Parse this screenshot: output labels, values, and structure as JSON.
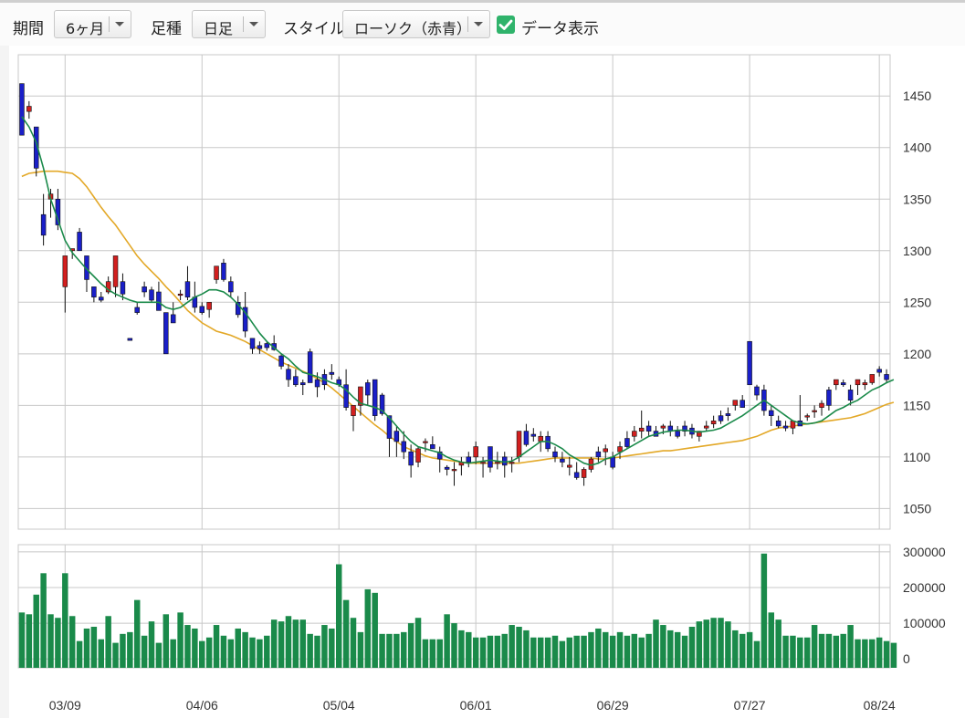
{
  "toolbar": {
    "period_label": "期間",
    "period_value": "6ヶ月",
    "candle_label": "足種",
    "candle_value": "日足",
    "style_label": "スタイル",
    "style_value": "ローソク（赤青）",
    "data_display_label": "データ表示",
    "data_display_checked": true
  },
  "colors": {
    "up": "#d21f1f",
    "down": "#1a1fc8",
    "ma_short": "#1a8a4a",
    "ma_long": "#e3a827",
    "volume": "#1a8a4a",
    "grid": "#c8c8c8"
  },
  "chart_data": [
    {
      "type": "candlestick",
      "ylim": [
        1030,
        1490
      ],
      "y_ticks": [
        1050,
        1100,
        1150,
        1200,
        1250,
        1300,
        1350,
        1400,
        1450
      ],
      "x_ticks": [
        "03/09",
        "04/06",
        "05/04",
        "06/01",
        "06/29",
        "07/27",
        "08/24"
      ],
      "x_tick_index": [
        6,
        25,
        44,
        63,
        82,
        101,
        119
      ],
      "candles": [
        [
          1462,
          1412,
          1462,
          1412
        ],
        [
          1435,
          1445,
          1428,
          1440
        ],
        [
          1420,
          1420,
          1372,
          1380
        ],
        [
          1335,
          1355,
          1305,
          1315
        ],
        [
          1350,
          1360,
          1332,
          1355
        ],
        [
          1350,
          1360,
          1320,
          1325
        ],
        [
          1265,
          1265,
          1240,
          1295
        ],
        [
          1300,
          1300,
          1292,
          1302
        ],
        [
          1318,
          1322,
          1300,
          1300
        ],
        [
          1295,
          1295,
          1260,
          1272
        ],
        [
          1265,
          1265,
          1250,
          1255
        ],
        [
          1255,
          1260,
          1250,
          1252
        ],
        [
          1260,
          1275,
          1258,
          1270
        ],
        [
          1265,
          1265,
          1255,
          1295
        ],
        [
          1270,
          1278,
          1252,
          1258
        ],
        [
          1215,
          1210,
          1225,
          1213
        ],
        [
          1245,
          1250,
          1238,
          1240
        ],
        [
          1265,
          1270,
          1255,
          1260
        ],
        [
          1262,
          1265,
          1250,
          1252
        ],
        [
          1260,
          1270,
          1250,
          1242
        ],
        [
          1240,
          1240,
          1200,
          1200
        ],
        [
          1238,
          1250,
          1230,
          1230
        ],
        [
          1258,
          1262,
          1252,
          1258
        ],
        [
          1270,
          1285,
          1252,
          1255
        ],
        [
          1255,
          1270,
          1240,
          1245
        ],
        [
          1246,
          1250,
          1238,
          1240
        ],
        [
          1243,
          1250,
          1235,
          1250
        ],
        [
          1272,
          1275,
          1268,
          1285
        ],
        [
          1288,
          1292,
          1270,
          1272
        ],
        [
          1270,
          1275,
          1255,
          1260
        ],
        [
          1250,
          1256,
          1235,
          1238
        ],
        [
          1245,
          1260,
          1216,
          1222
        ],
        [
          1215,
          1215,
          1200,
          1205
        ],
        [
          1208,
          1212,
          1200,
          1205
        ],
        [
          1210,
          1212,
          1203,
          1206
        ],
        [
          1210,
          1218,
          1203,
          1204
        ],
        [
          1198,
          1200,
          1185,
          1188
        ],
        [
          1185,
          1190,
          1168,
          1175
        ],
        [
          1178,
          1185,
          1168,
          1170
        ],
        [
          1172,
          1175,
          1160,
          1170
        ],
        [
          1202,
          1205,
          1172,
          1172
        ],
        [
          1175,
          1182,
          1158,
          1168
        ],
        [
          1180,
          1185,
          1165,
          1170
        ],
        [
          1182,
          1190,
          1175,
          1180
        ],
        [
          1175,
          1178,
          1168,
          1170
        ],
        [
          1170,
          1185,
          1145,
          1148
        ],
        [
          1140,
          1150,
          1125,
          1150
        ],
        [
          1150,
          1165,
          1140,
          1168
        ],
        [
          1172,
          1175,
          1150,
          1160
        ],
        [
          1175,
          1175,
          1135,
          1140
        ],
        [
          1160,
          1162,
          1140,
          1142
        ],
        [
          1140,
          1140,
          1100,
          1118
        ],
        [
          1125,
          1130,
          1100,
          1115
        ],
        [
          1115,
          1125,
          1098,
          1105
        ],
        [
          1105,
          1112,
          1080,
          1092
        ],
        [
          1095,
          1110,
          1090,
          1108
        ],
        [
          1115,
          1118,
          1105,
          1115
        ],
        [
          1112,
          1120,
          1110,
          1108
        ],
        [
          1105,
          1110,
          1085,
          1098
        ],
        [
          1090,
          1092,
          1082,
          1088
        ],
        [
          1088,
          1095,
          1072,
          1088
        ],
        [
          1092,
          1100,
          1082,
          1095
        ],
        [
          1100,
          1105,
          1090,
          1095
        ],
        [
          1100,
          1115,
          1093,
          1110
        ],
        [
          1095,
          1100,
          1080,
          1095
        ],
        [
          1110,
          1110,
          1085,
          1090
        ],
        [
          1095,
          1105,
          1088,
          1095
        ],
        [
          1100,
          1105,
          1080,
          1092
        ],
        [
          1095,
          1100,
          1085,
          1095
        ],
        [
          1100,
          1110,
          1095,
          1125
        ],
        [
          1125,
          1132,
          1110,
          1112
        ],
        [
          1122,
          1128,
          1115,
          1120
        ],
        [
          1115,
          1125,
          1105,
          1120
        ],
        [
          1120,
          1125,
          1105,
          1108
        ],
        [
          1105,
          1110,
          1095,
          1100
        ],
        [
          1098,
          1105,
          1090,
          1095
        ],
        [
          1090,
          1100,
          1082,
          1092
        ],
        [
          1085,
          1095,
          1078,
          1080
        ],
        [
          1080,
          1090,
          1072,
          1088
        ],
        [
          1088,
          1100,
          1085,
          1098
        ],
        [
          1105,
          1110,
          1095,
          1100
        ],
        [
          1105,
          1112,
          1092,
          1108
        ],
        [
          1100,
          1105,
          1088,
          1090
        ],
        [
          1105,
          1115,
          1098,
          1110
        ],
        [
          1118,
          1125,
          1108,
          1110
        ],
        [
          1120,
          1130,
          1115,
          1125
        ],
        [
          1125,
          1145,
          1118,
          1128
        ],
        [
          1130,
          1135,
          1120,
          1125
        ],
        [
          1125,
          1130,
          1120,
          1120
        ],
        [
          1128,
          1132,
          1122,
          1130
        ],
        [
          1130,
          1135,
          1120,
          1125
        ],
        [
          1125,
          1130,
          1118,
          1120
        ],
        [
          1130,
          1135,
          1120,
          1125
        ],
        [
          1128,
          1132,
          1118,
          1122
        ],
        [
          1120,
          1125,
          1115,
          1125
        ],
        [
          1128,
          1135,
          1125,
          1130
        ],
        [
          1132,
          1140,
          1128,
          1135
        ],
        [
          1140,
          1145,
          1132,
          1135
        ],
        [
          1142,
          1148,
          1135,
          1140
        ],
        [
          1150,
          1155,
          1145,
          1155
        ],
        [
          1155,
          1160,
          1148,
          1148
        ],
        [
          1212,
          1205,
          1175,
          1170
        ],
        [
          1168,
          1170,
          1155,
          1160
        ],
        [
          1165,
          1170,
          1140,
          1145
        ],
        [
          1145,
          1150,
          1130,
          1140
        ],
        [
          1135,
          1140,
          1128,
          1130
        ],
        [
          1130,
          1135,
          1125,
          1128
        ],
        [
          1128,
          1135,
          1122,
          1135
        ],
        [
          1135,
          1160,
          1130,
          1130
        ],
        [
          1140,
          1142,
          1135,
          1140
        ],
        [
          1145,
          1150,
          1138,
          1145
        ],
        [
          1148,
          1155,
          1140,
          1152
        ],
        [
          1165,
          1168,
          1145,
          1150
        ],
        [
          1170,
          1175,
          1165,
          1175
        ],
        [
          1172,
          1175,
          1168,
          1170
        ],
        [
          1165,
          1170,
          1150,
          1155
        ],
        [
          1170,
          1175,
          1160,
          1175
        ],
        [
          1170,
          1175,
          1165,
          1172
        ],
        [
          1172,
          1178,
          1170,
          1180
        ],
        [
          1185,
          1188,
          1178,
          1182
        ],
        [
          1180,
          1185,
          1172,
          1175
        ]
      ],
      "ma_short": [
        1430,
        1420,
        1405,
        1380,
        1350,
        1330,
        1310,
        1298,
        1290,
        1282,
        1275,
        1268,
        1262,
        1258,
        1255,
        1252,
        1250,
        1250,
        1250,
        1250,
        1245,
        1243,
        1245,
        1250,
        1255,
        1258,
        1262,
        1262,
        1260,
        1255,
        1248,
        1240,
        1230,
        1220,
        1212,
        1206,
        1200,
        1195,
        1188,
        1182,
        1180,
        1178,
        1175,
        1172,
        1170,
        1165,
        1158,
        1152,
        1150,
        1148,
        1145,
        1138,
        1130,
        1122,
        1115,
        1110,
        1108,
        1106,
        1104,
        1100,
        1097,
        1095,
        1094,
        1095,
        1096,
        1097,
        1096,
        1095,
        1096,
        1100,
        1105,
        1110,
        1115,
        1115,
        1112,
        1108,
        1102,
        1098,
        1094,
        1092,
        1094,
        1098,
        1100,
        1104,
        1108,
        1112,
        1116,
        1120,
        1122,
        1124,
        1125,
        1126,
        1126,
        1125,
        1124,
        1125,
        1126,
        1128,
        1132,
        1136,
        1140,
        1145,
        1150,
        1155,
        1150,
        1145,
        1140,
        1135,
        1133,
        1132,
        1133,
        1135,
        1140,
        1145,
        1148,
        1152,
        1155,
        1160,
        1165,
        1168,
        1172,
        1175
      ],
      "ma_long": [
        1372,
        1375,
        1376,
        1377,
        1377,
        1377,
        1376,
        1375,
        1370,
        1362,
        1352,
        1342,
        1333,
        1325,
        1315,
        1305,
        1295,
        1287,
        1280,
        1273,
        1265,
        1258,
        1250,
        1242,
        1236,
        1230,
        1226,
        1222,
        1220,
        1218,
        1215,
        1212,
        1208,
        1204,
        1200,
        1196,
        1192,
        1189,
        1186,
        1183,
        1180,
        1176,
        1172,
        1167,
        1161,
        1155,
        1149,
        1143,
        1137,
        1131,
        1126,
        1120,
        1115,
        1110,
        1107,
        1104,
        1101,
        1099,
        1098,
        1097,
        1096,
        1095,
        1094,
        1094,
        1094,
        1094,
        1094,
        1094,
        1094,
        1094,
        1095,
        1096,
        1097,
        1098,
        1099,
        1099,
        1099,
        1099,
        1099,
        1099,
        1098,
        1098,
        1099,
        1100,
        1101,
        1102,
        1103,
        1104,
        1105,
        1106,
        1106,
        1107,
        1108,
        1109,
        1110,
        1111,
        1112,
        1113,
        1114,
        1115,
        1116,
        1118,
        1120,
        1123,
        1126,
        1128,
        1129,
        1130,
        1131,
        1132,
        1133,
        1134,
        1135,
        1136,
        1137,
        1138,
        1140,
        1142,
        1145,
        1148,
        1151,
        1153
      ]
    },
    {
      "type": "bar",
      "series_name": "volume",
      "ylim": [
        -25000,
        320000
      ],
      "y_ticks": [
        0,
        100000,
        200000,
        300000
      ],
      "values": [
        130000,
        125000,
        180000,
        240000,
        125000,
        115000,
        240000,
        120000,
        50000,
        85000,
        90000,
        55000,
        120000,
        45000,
        70000,
        75000,
        165000,
        65000,
        105000,
        45000,
        125000,
        55000,
        130000,
        95000,
        85000,
        50000,
        60000,
        95000,
        65000,
        55000,
        85000,
        75000,
        60000,
        55000,
        65000,
        110000,
        105000,
        120000,
        110000,
        110000,
        70000,
        65000,
        95000,
        85000,
        265000,
        165000,
        115000,
        75000,
        195000,
        185000,
        70000,
        70000,
        70000,
        75000,
        100000,
        115000,
        55000,
        55000,
        55000,
        125000,
        100000,
        80000,
        75000,
        60000,
        60000,
        65000,
        65000,
        70000,
        95000,
        90000,
        80000,
        60000,
        60000,
        60000,
        65000,
        50000,
        60000,
        65000,
        65000,
        75000,
        85000,
        75000,
        65000,
        75000,
        65000,
        70000,
        60000,
        70000,
        110000,
        95000,
        80000,
        75000,
        65000,
        90000,
        105000,
        110000,
        115000,
        115000,
        105000,
        80000,
        70000,
        75000,
        50000,
        295000,
        130000,
        110000,
        65000,
        65000,
        60000,
        60000,
        95000,
        70000,
        70000,
        65000,
        70000,
        95000,
        55000,
        55000,
        55000,
        60000,
        50000,
        45000
      ]
    }
  ]
}
